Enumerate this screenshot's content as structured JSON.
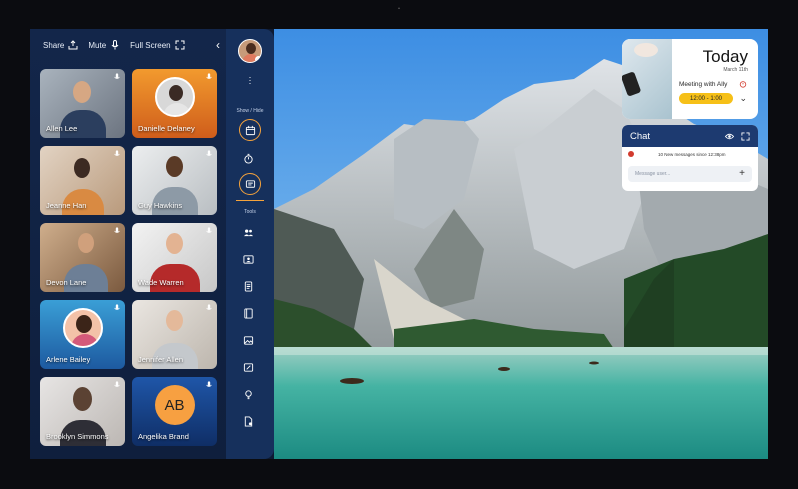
{
  "topbar": {
    "share_label": "Share",
    "mute_label": "Mute",
    "fullscreen_label": "Full Screen",
    "collapse_icon": "chevron-left-icon"
  },
  "participants": [
    {
      "name": "Allen Lee",
      "mic_icon": "microphone-icon"
    },
    {
      "name": "Danielle Delaney",
      "mic_icon": "microphone-icon"
    },
    {
      "name": "Jeanne Han",
      "mic_icon": "microphone-icon"
    },
    {
      "name": "Guy Hawkins",
      "mic_icon": "microphone-icon"
    },
    {
      "name": "Devon Lane",
      "mic_icon": "microphone-icon"
    },
    {
      "name": "Wade Warren",
      "mic_icon": "microphone-icon"
    },
    {
      "name": "Arlene Bailey",
      "mic_icon": "microphone-icon"
    },
    {
      "name": "Jennifer Allen",
      "mic_icon": "microphone-icon"
    },
    {
      "name": "Brooklyn Simmons",
      "mic_icon": "microphone-icon"
    },
    {
      "name": "Angelika Brand",
      "initials": "AB",
      "mic_icon": "microphone-icon"
    }
  ],
  "rail": {
    "show_hide_label": "Show / Hide",
    "tools_label": "Tools"
  },
  "today_card": {
    "title": "Today",
    "date": "March 11th",
    "meeting": "Meeting with Ally",
    "time": "12:00 - 1:00"
  },
  "chat": {
    "title": "Chat",
    "new_messages": "10  New messages since 12:38pm",
    "placeholder": "Message user...",
    "add_icon": "plus-icon"
  },
  "colors": {
    "panel": "#13264a",
    "rail": "#16305c",
    "accent_orange": "#f5a33c",
    "time_badge": "#f6c018",
    "chat_header": "#1d3a70"
  }
}
